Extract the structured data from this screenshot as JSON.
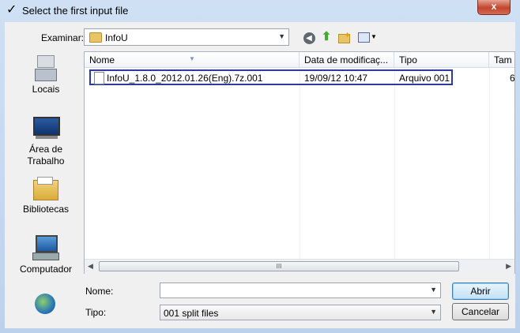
{
  "window": {
    "title": "Select the first input file",
    "title_icon": "checkmark-icon",
    "close_label": "x"
  },
  "lookin": {
    "label": "Examinar:",
    "value": "InfoU"
  },
  "toolbar": {
    "back_icon": "back-arrow-icon",
    "up_icon": "up-folder-icon",
    "newfolder_icon": "new-folder-icon",
    "views_icon": "views-menu-icon"
  },
  "places": [
    {
      "label": "Locais",
      "icon": "recent-places-icon"
    },
    {
      "label": "Área de\nTrabalho",
      "icon": "desktop-icon"
    },
    {
      "label": "Bibliotecas",
      "icon": "libraries-icon"
    },
    {
      "label": "Computador",
      "icon": "computer-icon"
    },
    {
      "label": "",
      "icon": "network-icon"
    }
  ],
  "filelist": {
    "columns": [
      "Nome",
      "Data de modificaç...",
      "Tipo",
      "Tam"
    ],
    "rows": [
      {
        "name": "InfoU_1.8.0_2012.01.26(Eng).7z.001",
        "date": "19/09/12 10:47",
        "type": "Arquivo 001",
        "size": "6"
      }
    ],
    "scroll_grip": "III"
  },
  "form": {
    "name_label": "Nome:",
    "name_value": "",
    "type_label": "Tipo:",
    "type_value": "001 split files",
    "open_button": "Abrir",
    "cancel_button": "Cancelar"
  },
  "colors": {
    "selection_border": "#2e3a9e",
    "title_bar": "#cfe0f4",
    "close_button": "#c0452e"
  }
}
